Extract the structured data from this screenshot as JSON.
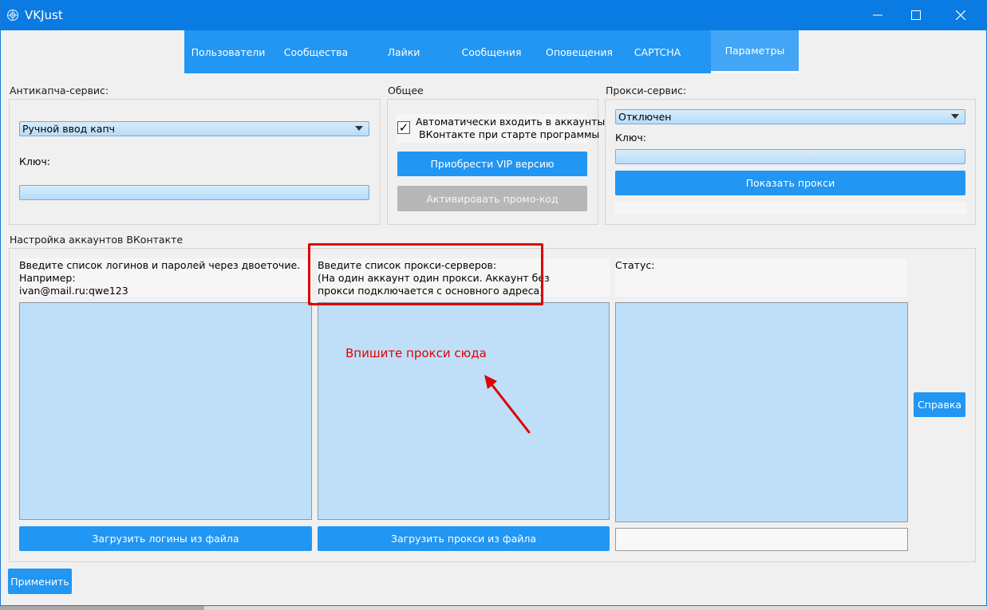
{
  "window": {
    "title": "VKJust",
    "accent": "#0a7be2",
    "icon": "app-logo-icon",
    "controls": [
      "minimize-icon",
      "maximize-icon",
      "close-icon"
    ]
  },
  "tabs": [
    {
      "label": "Пользователи",
      "active": false
    },
    {
      "label": "Сообщества",
      "active": false
    },
    {
      "label": "Лайки",
      "active": false
    },
    {
      "label": "Сообщения",
      "active": false
    },
    {
      "label": "Оповещения",
      "active": false
    },
    {
      "label": "CAPTCHA",
      "active": false
    },
    {
      "label": "Параметры",
      "active": true
    }
  ],
  "anticaptcha": {
    "heading": "Антикапча-сервис:",
    "service_value": "Ручной ввод капч",
    "key_label": "Ключ:",
    "key_value": ""
  },
  "general": {
    "heading": "Общее",
    "auto_login_checked": true,
    "auto_login_line1": "Автоматически входить в аккаунты",
    "auto_login_line2": "ВКонтакте при старте программы",
    "buy_vip_label": "Приобрести VIP версию",
    "activate_promo_label": "Активировать промо-код"
  },
  "proxy_service": {
    "heading": "Прокси-сервис:",
    "service_value": "Отключен",
    "key_label": "Ключ:",
    "key_value": "",
    "show_proxy_label": "Показать прокси"
  },
  "accounts": {
    "heading": "Настройка аккаунтов ВКонтакте",
    "logins_hint_line1": "Введите список логинов и паролей через двоеточие.",
    "logins_hint_line2": "Например:",
    "logins_hint_line3": "ivan@mail.ru:qwe123",
    "proxy_hint_line1": "Введите список прокси-серверов:",
    "proxy_hint_line2": "(На один аккаунт один прокси. Аккаунт без",
    "proxy_hint_line3": "прокси подключается с основного адреса)",
    "status_label": "Статус:",
    "load_logins_label": "Загрузить логины из файла",
    "load_proxy_label": "Загрузить прокси из файла",
    "help_label": "Справка"
  },
  "annotation": {
    "text": "Впишите прокси сюда",
    "color": "#e00000"
  },
  "apply_label": "Применить"
}
